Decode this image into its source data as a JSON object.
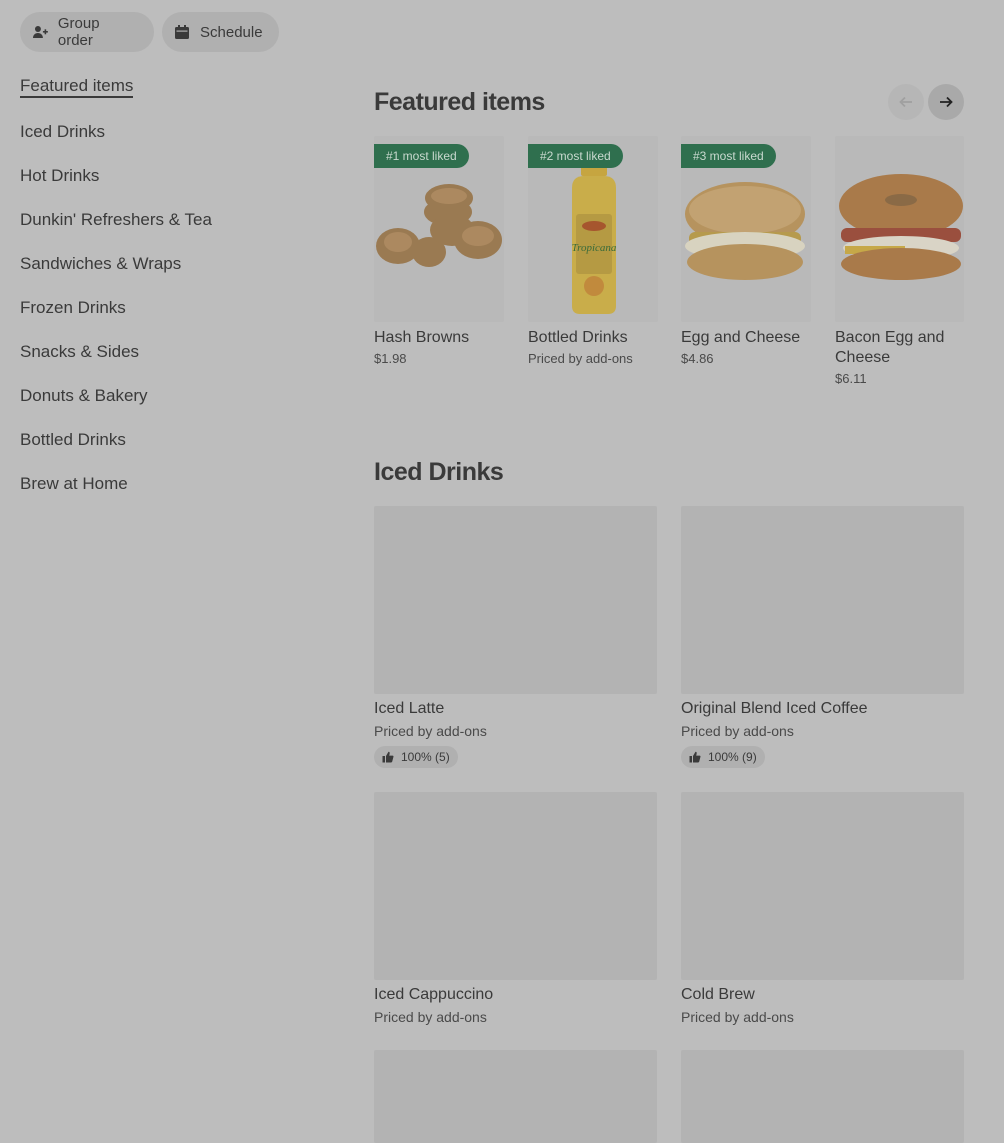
{
  "top_actions": {
    "group_order": "Group order",
    "schedule": "Schedule"
  },
  "sidebar": {
    "items": [
      {
        "label": "Featured items",
        "active": true
      },
      {
        "label": "Iced Drinks"
      },
      {
        "label": "Hot Drinks"
      },
      {
        "label": "Dunkin' Refreshers & Tea"
      },
      {
        "label": "Sandwiches & Wraps"
      },
      {
        "label": "Frozen Drinks"
      },
      {
        "label": "Snacks & Sides"
      },
      {
        "label": "Donuts & Bakery"
      },
      {
        "label": "Bottled Drinks"
      },
      {
        "label": "Brew at Home"
      }
    ]
  },
  "featured": {
    "title": "Featured items",
    "items": [
      {
        "badge": "#1 most liked",
        "name": "Hash Browns",
        "price": "$1.98",
        "icon": "hash-browns-image"
      },
      {
        "badge": "#2 most liked",
        "name": "Bottled Drinks",
        "price": "Priced by add-ons",
        "icon": "orange-juice-bottle-image"
      },
      {
        "badge": "#3 most liked",
        "name": "Egg and Cheese",
        "price": "$4.86",
        "icon": "egg-cheese-sandwich-image"
      },
      {
        "badge": "",
        "name": "Bacon Egg and Cheese",
        "price": "$6.11",
        "icon": "bacon-egg-cheese-bagel-image"
      }
    ]
  },
  "iced_drinks": {
    "title": "Iced Drinks",
    "items": [
      {
        "name": "Iced Latte",
        "price": "Priced by add-ons",
        "rating": "100% (5)"
      },
      {
        "name": "Original Blend Iced Coffee",
        "price": "Priced by add-ons",
        "rating": "100% (9)"
      },
      {
        "name": "Iced Cappuccino",
        "price": "Priced by add-ons",
        "rating": ""
      },
      {
        "name": "Cold Brew",
        "price": "Priced by add-ons",
        "rating": ""
      }
    ]
  },
  "colors": {
    "overlay_bg": "#bdbdbd",
    "badge_green": "#2f6f4e"
  }
}
